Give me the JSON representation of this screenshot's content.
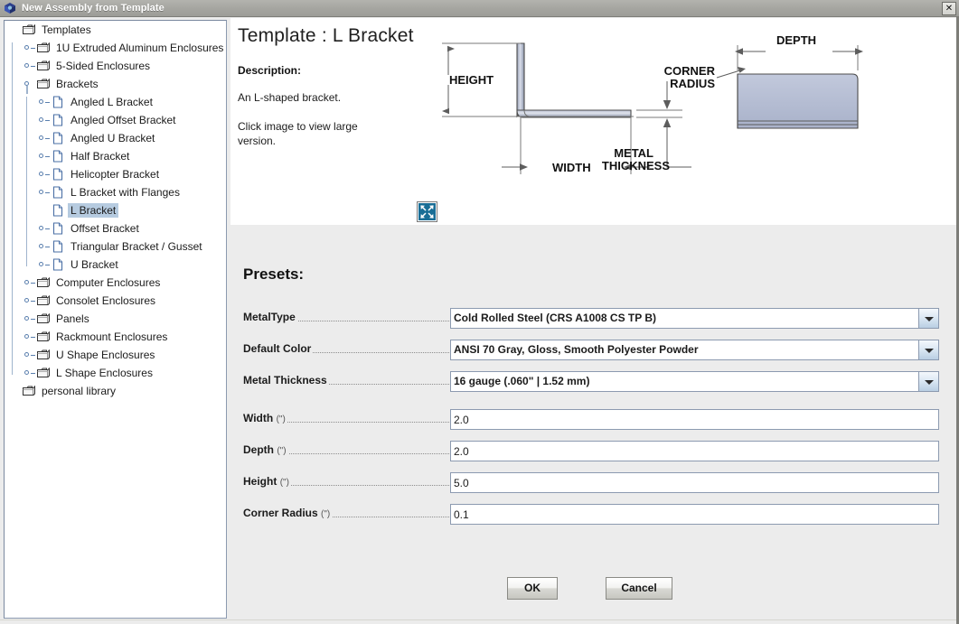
{
  "window": {
    "title": "New Assembly from Template",
    "icon": "assembly-cube-icon",
    "close_label": "✕"
  },
  "tree": {
    "root_label": "Templates",
    "items": [
      {
        "label": "Templates",
        "depth": 0,
        "type": "folder",
        "handle": "none",
        "selected": false
      },
      {
        "label": "1U Extruded Aluminum Enclosures",
        "depth": 1,
        "type": "folder",
        "handle": "collapsed",
        "selected": false
      },
      {
        "label": "5-Sided Enclosures",
        "depth": 1,
        "type": "folder",
        "handle": "collapsed",
        "selected": false
      },
      {
        "label": "Brackets",
        "depth": 1,
        "type": "folder",
        "handle": "expanded",
        "selected": false
      },
      {
        "label": "Angled L Bracket",
        "depth": 2,
        "type": "file",
        "handle": "collapsed",
        "selected": false
      },
      {
        "label": "Angled Offset Bracket",
        "depth": 2,
        "type": "file",
        "handle": "collapsed",
        "selected": false
      },
      {
        "label": "Angled U Bracket",
        "depth": 2,
        "type": "file",
        "handle": "collapsed",
        "selected": false
      },
      {
        "label": "Half Bracket",
        "depth": 2,
        "type": "file",
        "handle": "collapsed",
        "selected": false
      },
      {
        "label": "Helicopter Bracket",
        "depth": 2,
        "type": "file",
        "handle": "collapsed",
        "selected": false
      },
      {
        "label": "L Bracket with Flanges",
        "depth": 2,
        "type": "file",
        "handle": "collapsed",
        "selected": false
      },
      {
        "label": "L Bracket",
        "depth": 2,
        "type": "file",
        "handle": "none",
        "selected": true
      },
      {
        "label": "Offset Bracket",
        "depth": 2,
        "type": "file",
        "handle": "collapsed",
        "selected": false
      },
      {
        "label": "Triangular Bracket / Gusset",
        "depth": 2,
        "type": "file",
        "handle": "collapsed",
        "selected": false
      },
      {
        "label": "U Bracket",
        "depth": 2,
        "type": "file",
        "handle": "collapsed",
        "selected": false
      },
      {
        "label": "Computer Enclosures",
        "depth": 1,
        "type": "folder",
        "handle": "collapsed",
        "selected": false
      },
      {
        "label": "Consolet Enclosures",
        "depth": 1,
        "type": "folder",
        "handle": "collapsed",
        "selected": false
      },
      {
        "label": "Panels",
        "depth": 1,
        "type": "folder",
        "handle": "collapsed",
        "selected": false
      },
      {
        "label": "Rackmount Enclosures",
        "depth": 1,
        "type": "folder",
        "handle": "collapsed",
        "selected": false
      },
      {
        "label": "U Shape Enclosures",
        "depth": 1,
        "type": "folder",
        "handle": "collapsed",
        "selected": false
      },
      {
        "label": "L Shape Enclosures",
        "depth": 1,
        "type": "folder",
        "handle": "collapsed",
        "selected": false
      },
      {
        "label": "personal library",
        "depth": 0,
        "type": "folder",
        "handle": "none",
        "selected": false
      }
    ]
  },
  "header": {
    "title": "Template : L Bracket"
  },
  "description": {
    "heading": "Description:",
    "text": "An L-shaped bracket.",
    "hint": "Click image to view large version.",
    "expand_icon": "expand-arrows-icon"
  },
  "diagram": {
    "labels": {
      "height": "HEIGHT",
      "width": "WIDTH",
      "depth": "DEPTH",
      "corner_radius_line1": "CORNER",
      "corner_radius_line2": "RADIUS",
      "metal_thickness_line1": "METAL",
      "metal_thickness_line2": "THICKNESS"
    },
    "colors": {
      "metal_fill_light": "#d3d8e6",
      "metal_fill_dark": "#9aa3b8",
      "line": "#6e6e6e"
    }
  },
  "presets": {
    "heading": "Presets:",
    "combos": [
      {
        "label": "MetalType",
        "unit": "",
        "value": "Cold Rolled Steel (CRS A1008 CS TP B)",
        "name": "metal-type"
      },
      {
        "label": "Default Color",
        "unit": "",
        "value": "ANSI 70 Gray, Gloss, Smooth Polyester Powder",
        "name": "default-color"
      },
      {
        "label": "Metal Thickness",
        "unit": "",
        "value": "16 gauge (.060\" | 1.52 mm)",
        "name": "metal-thickness"
      }
    ],
    "inputs": [
      {
        "label": "Width",
        "unit": "(\")",
        "value": "2.0",
        "name": "width"
      },
      {
        "label": "Depth",
        "unit": "(\")",
        "value": "2.0",
        "name": "depth"
      },
      {
        "label": "Height",
        "unit": "(\")",
        "value": "5.0",
        "name": "height"
      },
      {
        "label": "Corner Radius",
        "unit": "(\")",
        "value": "0.1",
        "name": "corner-radius"
      }
    ]
  },
  "actions": {
    "ok_label": "OK",
    "cancel_label": "Cancel"
  },
  "colors": {
    "titlebar": "#a6a6a1",
    "panel_bg": "#ececec",
    "selection": "#b6cbe0",
    "field_border": "#8c9ab0",
    "accent_blue": "#1a6e96"
  }
}
